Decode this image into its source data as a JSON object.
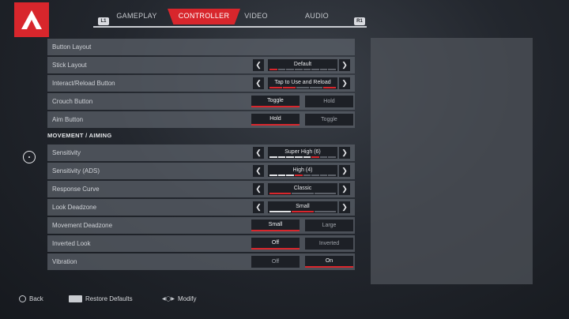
{
  "header": {
    "tabs": [
      {
        "label": "GAMEPLAY",
        "active": false
      },
      {
        "label": "CONTROLLER",
        "active": true
      },
      {
        "label": "VIDEO",
        "active": false
      },
      {
        "label": "AUDIO",
        "active": false
      }
    ],
    "bumper_left": "L1",
    "bumper_right": "R1"
  },
  "controller": {
    "rows": [
      {
        "label": "Button Layout"
      },
      {
        "label": "Stick Layout",
        "value": "Default"
      },
      {
        "label": "Interact/Reload Button",
        "value": "Tap to Use and Reload"
      },
      {
        "label": "Crouch Button",
        "options": [
          "Toggle",
          "Hold"
        ],
        "selected": 0
      },
      {
        "label": "Aim Button",
        "options": [
          "Hold",
          "Toggle"
        ],
        "selected": 0
      }
    ]
  },
  "movement": {
    "heading": "MOVEMENT / AIMING",
    "rows": [
      {
        "label": "Sensitivity",
        "value": "Super High (6)",
        "level": 6,
        "steps": 8
      },
      {
        "label": "Sensitivity (ADS)",
        "value": "High (4)",
        "level": 4,
        "steps": 8
      },
      {
        "label": "Response Curve",
        "value": "Classic",
        "level": 1,
        "steps": 3
      },
      {
        "label": "Look Deadzone",
        "value": "Small",
        "level": 2,
        "steps": 3
      },
      {
        "label": "Movement Deadzone",
        "options": [
          "Small",
          "Large"
        ],
        "selected": 0
      },
      {
        "label": "Inverted Look",
        "options": [
          "Off",
          "Inverted"
        ],
        "selected": 0
      },
      {
        "label": "Vibration",
        "options": [
          "Off",
          "On"
        ],
        "selected": 1
      }
    ]
  },
  "footer": {
    "back": "Back",
    "restore": "Restore Defaults",
    "modify": "Modify"
  },
  "colors": {
    "accent": "#d8262c",
    "row_bg": "#5c616a",
    "control_bg": "#1d2026"
  }
}
